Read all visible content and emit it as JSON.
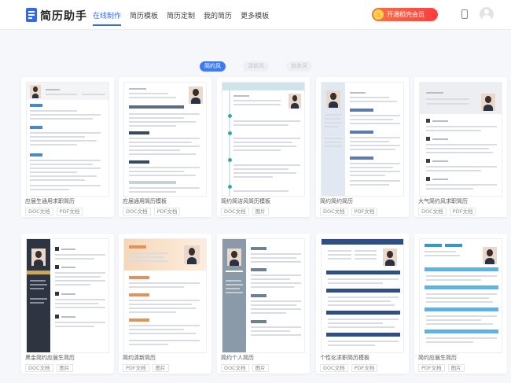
{
  "app": {
    "name": "简历助手"
  },
  "nav": [
    "在线制作",
    "简历模板",
    "简历定制",
    "我的简历",
    "更多模板"
  ],
  "vip_button": "开通稻壳会员",
  "filters": [
    "简约风",
    "清新风",
    "商务风"
  ],
  "cards": [
    {
      "title": "应届生通用求职简历",
      "tags": [
        "DOC文档",
        "PDF文档"
      ]
    },
    {
      "title": "应届通用简历模板",
      "tags": [
        "DOC文档",
        "PDF文档"
      ]
    },
    {
      "title": "简约简洁风简历模板",
      "tags": [
        "DOC文档",
        "图片"
      ]
    },
    {
      "title": "简约简约简历",
      "tags": [
        "DOC文档",
        "PDF文档"
      ]
    },
    {
      "title": "大气简约风求职简历",
      "tags": [
        "DOC文档",
        "PDF文档"
      ]
    },
    {
      "title": "黑金简约应届生简历",
      "tags": [
        "DOC文档",
        "图片"
      ]
    },
    {
      "title": "简约清新简历",
      "tags": [
        "PDF文档",
        "图片"
      ]
    },
    {
      "title": "简约个人简历",
      "tags": [
        "DOC文档",
        "图片"
      ]
    },
    {
      "title": "个性化求职简历模板",
      "tags": [
        "DOC文档",
        "PDF文档"
      ]
    },
    {
      "title": "简约应届生简历",
      "tags": [
        "PDF文档",
        "图片"
      ]
    }
  ],
  "colors": {
    "accent": "#2f6bf2",
    "vip": "#ff4a3d"
  }
}
